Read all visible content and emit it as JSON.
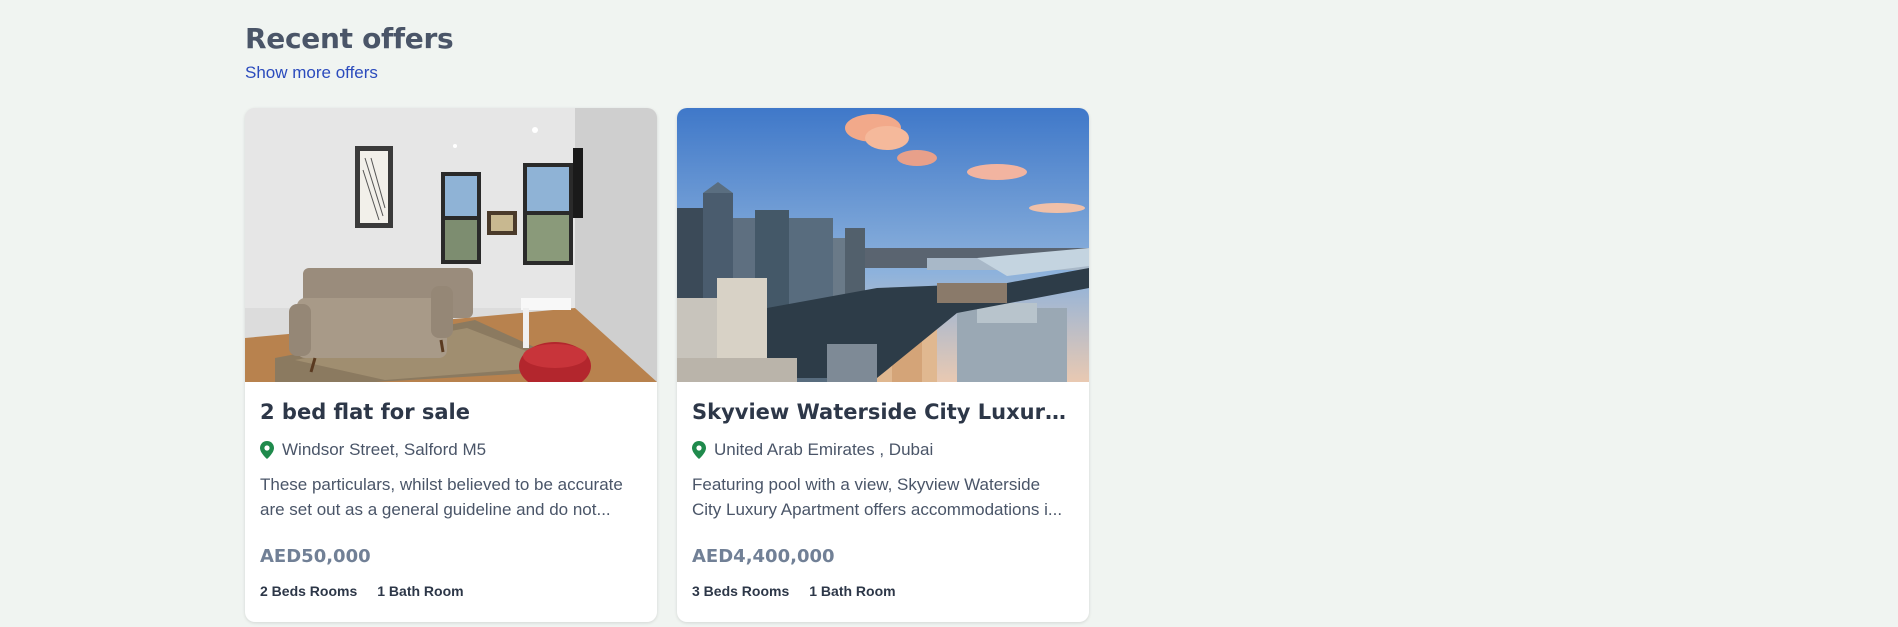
{
  "section": {
    "title": "Recent offers",
    "show_more_label": "Show more offers"
  },
  "colors": {
    "accent_link": "#2b4bbd",
    "pin": "#1f8a4c",
    "background": "#f0f4f1"
  },
  "offers": [
    {
      "title": "2 bed flat for sale",
      "location": "Windsor Street, Salford M5",
      "description": "These particulars, whilst believed to be accurate are set out as a general guideline and do not...",
      "price": "AED50,000",
      "beds": "2 Beds Rooms",
      "baths": "1 Bath Room",
      "image": "living-room-photo"
    },
    {
      "title": "Skyview Waterside City Luxury Apa...",
      "location": "United Arab Emirates , Dubai",
      "description": "Featuring pool with a view, Skyview Waterside City Luxury Apartment offers accommodations i...",
      "price": "AED4,400,000",
      "beds": "3 Beds Rooms",
      "baths": "1 Bath Room",
      "image": "city-skyline-photo"
    }
  ]
}
